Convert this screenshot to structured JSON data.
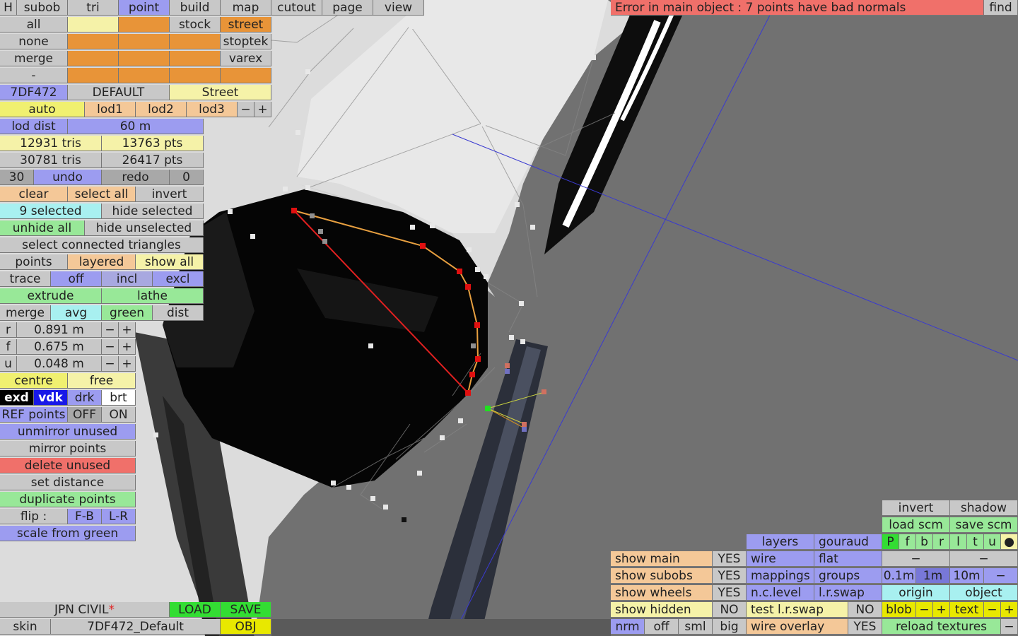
{
  "menu": {
    "h": "H",
    "items": [
      "subob",
      "tri",
      "point",
      "build",
      "map",
      "cutout",
      "page",
      "view"
    ],
    "active": "point"
  },
  "status": {
    "error": "Error in main object : 7 points have bad normals",
    "find": "find"
  },
  "group_rows": {
    "all": "all",
    "none": "none",
    "merge": "merge",
    "dash": "-",
    "stock": "stock",
    "street": "street",
    "stoptek": "stoptek",
    "varex": "varex"
  },
  "car": {
    "id": "7DF472",
    "preset": "DEFAULT",
    "category": "Street"
  },
  "lod": {
    "auto": "auto",
    "lod1": "lod1",
    "lod2": "lod2",
    "lod3": "lod3",
    "minus": "−",
    "plus": "+",
    "dist_label": "lod dist",
    "dist_value": "60 m"
  },
  "stats": {
    "tris_sel": "12931 tris",
    "pts_sel": "13763 pts",
    "tris_total": "30781 tris",
    "pts_total": "26417 pts"
  },
  "undo": {
    "left_count": "30",
    "undo": "undo",
    "redo": "redo",
    "right_count": "0"
  },
  "selection": {
    "clear": "clear",
    "select_all": "select all",
    "invert": "invert",
    "selected": "9 selected",
    "hide_selected": "hide selected",
    "unhide_all": "unhide all",
    "hide_unselected": "hide unselected",
    "select_connected": "select connected triangles"
  },
  "points": {
    "points": "points",
    "layered": "layered",
    "show_all": "show all",
    "trace": "trace",
    "off": "off",
    "incl": "incl",
    "excl": "excl",
    "extrude": "extrude",
    "lathe": "lathe",
    "merge": "merge",
    "avg": "avg",
    "green": "green",
    "dist": "dist"
  },
  "params": [
    {
      "key": "r",
      "value": "0.891 m"
    },
    {
      "key": "f",
      "value": "0.675 m"
    },
    {
      "key": "u",
      "value": "0.048 m"
    }
  ],
  "tools": {
    "centre": "centre",
    "free": "free",
    "exd": "exd",
    "vdk": "vdk",
    "drk": "drk",
    "brt": "brt",
    "ref_points": "REF points",
    "off": "OFF",
    "on": "ON",
    "unmirror_unused": "unmirror unused",
    "mirror_points": "mirror points",
    "delete_unused": "delete unused",
    "set_distance": "set distance",
    "duplicate_points": "duplicate points",
    "flip": "flip :",
    "fb": "F-B",
    "lr": "L-R",
    "scale_from_green": "scale from green"
  },
  "file": {
    "name": "JPN CIVIL",
    "star": "*",
    "load": "LOAD",
    "save": "SAVE",
    "skin_label": "skin",
    "skin_value": "7DF472_Default",
    "obj": "OBJ"
  },
  "view_panel": {
    "invert": "invert",
    "shadow": "shadow",
    "load_scm": "load scm",
    "save_scm": "save scm",
    "views": [
      "P",
      "f",
      "b",
      "r",
      "l",
      "t",
      "u",
      "●"
    ],
    "layers": "layers",
    "gouraud": "gouraud",
    "wire": "wire",
    "flat": "flat",
    "mappings": "mappings",
    "groups": "groups",
    "nc_level": "n.c.level",
    "lr_swap": "l.r.swap",
    "test_lr_swap": "test l.r.swap",
    "test_lr_swap_val": "NO",
    "wire_overlay": "wire overlay",
    "wire_overlay_val": "YES",
    "show_main": "show main",
    "show_main_val": "YES",
    "show_subobs": "show subobs",
    "show_subobs_val": "YES",
    "show_wheels": "show wheels",
    "show_wheels_val": "YES",
    "show_hidden": "show hidden",
    "show_hidden_val": "NO",
    "nrm": "nrm",
    "off": "off",
    "sml": "sml",
    "big": "big",
    "dash": "−",
    "step_01": "0.1m",
    "step_1": "1m",
    "step_10": "10m",
    "origin": "origin",
    "object": "object",
    "blob": "blob",
    "text": "text",
    "minus": "−",
    "plus": "+",
    "reload": "reload textures"
  },
  "colors": {
    "button_grey": "#c8c8c8",
    "button_blue": "#9c9cf0",
    "button_orange": "#e89438",
    "error_red": "#f0706a",
    "load_green": "#33dd33",
    "obj_yellow": "#e8e800"
  }
}
